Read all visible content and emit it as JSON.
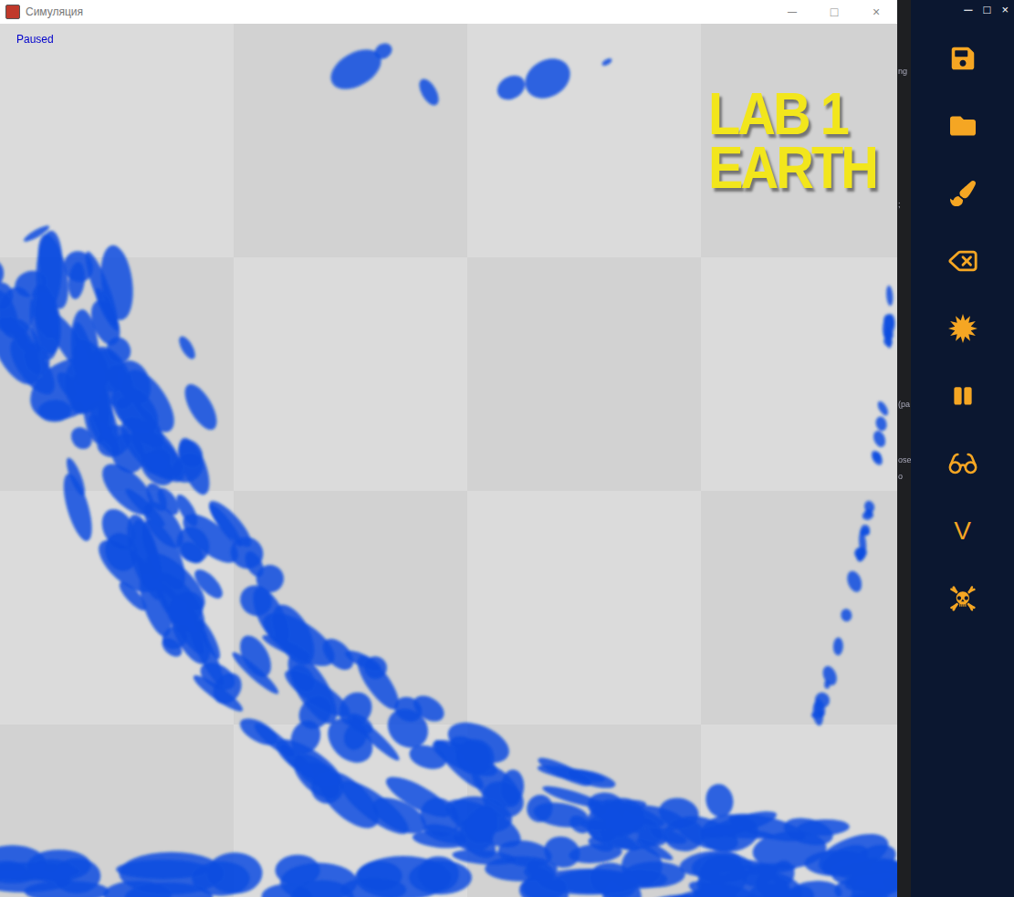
{
  "simulation_window": {
    "title": "Симуляция",
    "controls": [
      "─",
      "□",
      "×"
    ],
    "status": "Paused",
    "logo": [
      "LAB 1",
      "EARTH"
    ]
  },
  "toolbar_window": {
    "controls": [
      "─",
      "□",
      "×"
    ]
  },
  "toolbar": {
    "letter_button": "V"
  },
  "background_fragments": [
    "ng",
    ";",
    "(pa",
    "ose",
    "o"
  ]
}
